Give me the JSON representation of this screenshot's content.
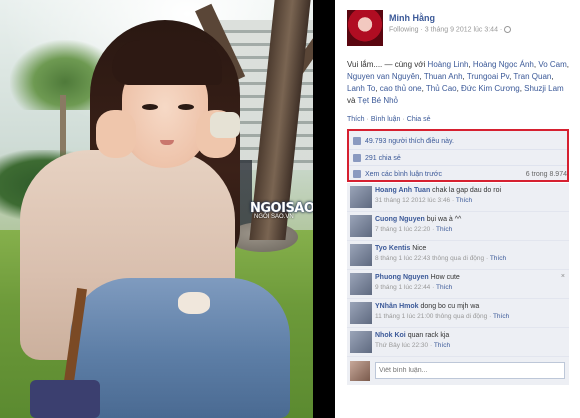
{
  "watermark": {
    "brand": "NGOISAO",
    "star": "★",
    "sub": "NGÔI SAO.VN"
  },
  "post": {
    "author": "Minh Hằng",
    "meta": "Following · 3 tháng 9 2012 lúc 3:44 ·",
    "text_prefix": "Vui lắm.... — cùng với",
    "tagged": [
      "Hoàng Linh",
      "Hoàng Ngọc Ánh",
      "Vo Cam",
      "Nguyen van Nguyên",
      "Thuan Anh",
      "Trungoai Pv",
      "Tran Quan",
      "Lanh To",
      "cao thủ one",
      "Thủ Cao",
      "Đức Kim Cương",
      "Shuzji Lam"
    ],
    "text_and": "và",
    "last_tag": "Tẹt Bé Nhỏ",
    "actions": {
      "like": "Thích",
      "comment": "Bình luận",
      "share": "Chia sẻ"
    }
  },
  "stats": {
    "likes": "49.793 người thích điều này.",
    "shares": "291 chia sẻ",
    "view_previous": "Xem các bình luận trước",
    "count": "6 trong 8.974"
  },
  "comments": [
    {
      "author": "Hoang Anh Tuan",
      "text": "chak la gap dau do roi",
      "meta": "31 tháng 12 2012 lúc 3:46",
      "like": "Thích",
      "close": ""
    },
    {
      "author": "Cuong Nguyen",
      "text": "bụi wa à ^^",
      "meta": "7 tháng 1 lúc 22:20",
      "like": "Thích",
      "close": ""
    },
    {
      "author": "Tyo Kentis",
      "text": "Nice",
      "meta": "8 tháng 1 lúc 22:43 thông qua di động",
      "like": "Thích",
      "close": ""
    },
    {
      "author": "Phuong Nguyen",
      "text": "How cute",
      "meta": "9 tháng 1 lúc 22:44",
      "like": "Thích",
      "close": "×"
    },
    {
      "author": "YNhân Hmok",
      "text": "dong bo cu mjh wa",
      "meta": "11 tháng 1 lúc 21:00 thông qua di động",
      "like": "Thích",
      "close": ""
    },
    {
      "author": "Nhok Koi",
      "text": "quan rack kja",
      "meta": "Thứ Bảy lúc 22:30",
      "like": "Thích",
      "close": ""
    }
  ],
  "reply": {
    "placeholder": "Viết bình luận..."
  }
}
